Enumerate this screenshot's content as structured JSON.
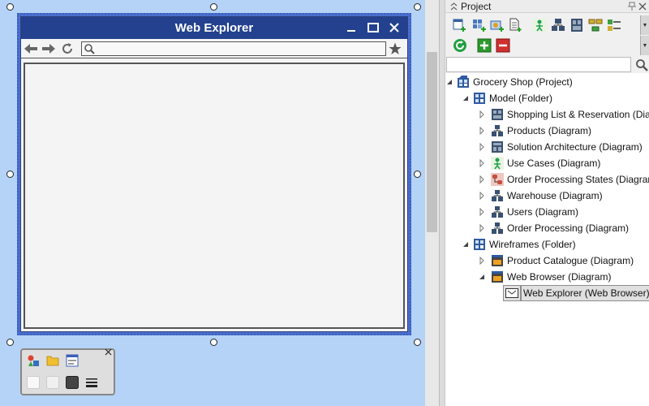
{
  "browser_mockup": {
    "title": "Web Explorer"
  },
  "panel": {
    "title": "Project",
    "search": {
      "value": "",
      "placeholder": ""
    }
  },
  "tree": {
    "project": "Grocery Shop (Project)",
    "model_folder": "Model (Folder)",
    "model_items": [
      {
        "label": "Shopping List & Reservation (Diagram)",
        "icon": "component-diagram-icon"
      },
      {
        "label": "Products (Diagram)",
        "icon": "class-diagram-icon"
      },
      {
        "label": "Solution Architecture (Diagram)",
        "icon": "deployment-diagram-icon"
      },
      {
        "label": "Use Cases (Diagram)",
        "icon": "use-case-diagram-icon"
      },
      {
        "label": "Order Processing States (Diagram)",
        "icon": "state-diagram-icon"
      },
      {
        "label": "Warehouse (Diagram)",
        "icon": "class-diagram-icon"
      },
      {
        "label": "Users (Diagram)",
        "icon": "class-diagram-icon"
      },
      {
        "label": "Order Processing (Diagram)",
        "icon": "activity-diagram-icon"
      }
    ],
    "wireframes_folder": "Wireframes (Folder)",
    "wireframe_items": [
      {
        "label": "Product Catalogue (Diagram)",
        "icon": "wireframe-diagram-icon"
      },
      {
        "label": "Web Browser (Diagram)",
        "icon": "wireframe-diagram-icon"
      }
    ],
    "selected_element": "Web Explorer (Web Browser)"
  },
  "colors": {
    "canvas_bg": "#b4d3f6",
    "mockup_titlebar": "#23418f",
    "selection": "#e0e0e0"
  }
}
